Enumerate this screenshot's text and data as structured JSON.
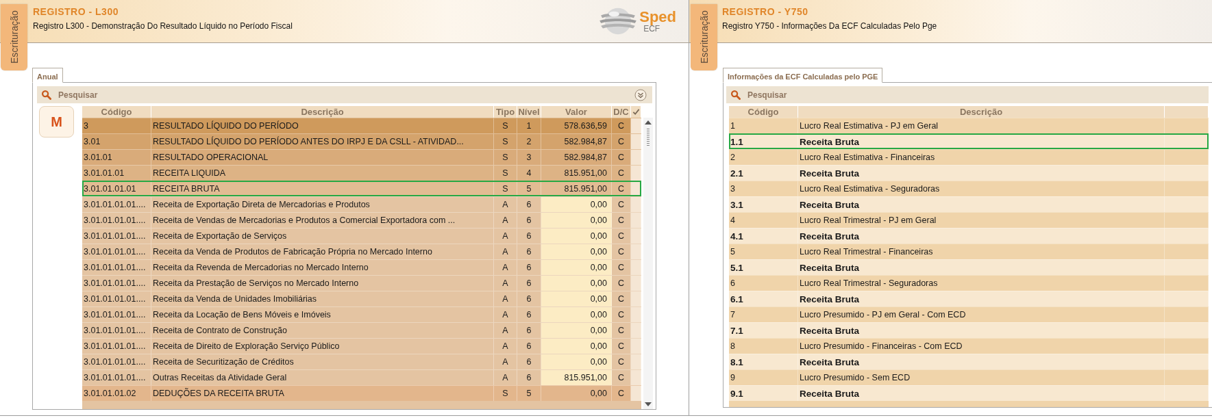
{
  "left_window": {
    "side_tab": "Escrituração",
    "title": "REGISTRO - L300",
    "subtitle": "Registro L300 - Demonstração Do Resultado Líquido no Período Fiscal",
    "logo": {
      "name": "Sped",
      "sub": "ECF"
    },
    "tabs": [
      {
        "label": "Anual",
        "selected": true
      }
    ],
    "search": {
      "label": "Pesquisar",
      "collapsible": true
    },
    "mode_badge": "M",
    "table": {
      "kind": "ledger",
      "columns": [
        "Código",
        "Descrição",
        "Tipo",
        "Nível",
        "Valor",
        "D/C"
      ],
      "rows": [
        {
          "codigo": "3",
          "descricao": "RESULTADO LÍQUIDO DO PERÍODO",
          "tipo": "S",
          "nivel": "1",
          "valor": "578.636,59",
          "dc": "C",
          "kind": "synthetic",
          "color": "#cf9a5c",
          "highlighted": false
        },
        {
          "codigo": "3.01",
          "descricao": "RESULTADO LÍQUIDO DO PERÍODO ANTES DO IRPJ E DA CSLL - ATIVIDAD...",
          "tipo": "S",
          "nivel": "2",
          "valor": "582.984,87",
          "dc": "C",
          "kind": "synthetic",
          "color": "#d4a36c",
          "highlighted": false
        },
        {
          "codigo": "3.01.01",
          "descricao": "RESULTADO OPERACIONAL",
          "tipo": "S",
          "nivel": "3",
          "valor": "582.984,87",
          "dc": "C",
          "kind": "synthetic",
          "color": "#d9ab7a",
          "highlighted": false
        },
        {
          "codigo": "3.01.01.01",
          "descricao": "RECEITA LIQUIDA",
          "tipo": "S",
          "nivel": "4",
          "valor": "815.951,00",
          "dc": "C",
          "kind": "synthetic",
          "color": "#ddb385",
          "highlighted": false
        },
        {
          "codigo": "3.01.01.01.01",
          "descricao": "RECEITA BRUTA",
          "tipo": "S",
          "nivel": "5",
          "valor": "815.951,00",
          "dc": "C",
          "kind": "synthetic",
          "color": "#e2bc93",
          "highlighted": true
        },
        {
          "codigo": "3.01.01.01.01....",
          "descricao": "Receita de Exportação Direta de Mercadorias e Produtos",
          "tipo": "A",
          "nivel": "6",
          "valor": "0,00",
          "dc": "C",
          "kind": "analytic",
          "color": "#e4c4a2",
          "highlighted": false
        },
        {
          "codigo": "3.01.01.01.01....",
          "descricao": "Receita de Vendas de Mercadorias e Produtos a Comercial Exportadora com ...",
          "tipo": "A",
          "nivel": "6",
          "valor": "0,00",
          "dc": "C",
          "kind": "analytic",
          "color": "#e4c4a2",
          "highlighted": false
        },
        {
          "codigo": "3.01.01.01.01....",
          "descricao": "Receita de Exportação de Serviços",
          "tipo": "A",
          "nivel": "6",
          "valor": "0,00",
          "dc": "C",
          "kind": "analytic",
          "color": "#e4c4a2",
          "highlighted": false
        },
        {
          "codigo": "3.01.01.01.01....",
          "descricao": "Receita da Venda de Produtos de Fabricação Própria no Mercado Interno",
          "tipo": "A",
          "nivel": "6",
          "valor": "0,00",
          "dc": "C",
          "kind": "analytic",
          "color": "#e4c4a2",
          "highlighted": false
        },
        {
          "codigo": "3.01.01.01.01....",
          "descricao": "Receita da Revenda de Mercadorias no Mercado Interno",
          "tipo": "A",
          "nivel": "6",
          "valor": "0,00",
          "dc": "C",
          "kind": "analytic",
          "color": "#e4c4a2",
          "highlighted": false
        },
        {
          "codigo": "3.01.01.01.01....",
          "descricao": "Receita da Prestação de Serviços no Mercado Interno",
          "tipo": "A",
          "nivel": "6",
          "valor": "0,00",
          "dc": "C",
          "kind": "analytic",
          "color": "#e4c4a2",
          "highlighted": false
        },
        {
          "codigo": "3.01.01.01.01....",
          "descricao": "Receita da Venda de Unidades Imobiliárias",
          "tipo": "A",
          "nivel": "6",
          "valor": "0,00",
          "dc": "C",
          "kind": "analytic",
          "color": "#e4c4a2",
          "highlighted": false
        },
        {
          "codigo": "3.01.01.01.01....",
          "descricao": "Receita da Locação de Bens Móveis e Imóveis",
          "tipo": "A",
          "nivel": "6",
          "valor": "0,00",
          "dc": "C",
          "kind": "analytic",
          "color": "#e4c4a2",
          "highlighted": false
        },
        {
          "codigo": "3.01.01.01.01....",
          "descricao": "Receita de Contrato de Construção",
          "tipo": "A",
          "nivel": "6",
          "valor": "0,00",
          "dc": "C",
          "kind": "analytic",
          "color": "#e4c4a2",
          "highlighted": false
        },
        {
          "codigo": "3.01.01.01.01....",
          "descricao": "Receita de Direito de Exploração Serviço Público",
          "tipo": "A",
          "nivel": "6",
          "valor": "0,00",
          "dc": "C",
          "kind": "analytic",
          "color": "#e4c4a2",
          "highlighted": false
        },
        {
          "codigo": "3.01.01.01.01....",
          "descricao": "Receita de Securitização de Créditos",
          "tipo": "A",
          "nivel": "6",
          "valor": "0,00",
          "dc": "C",
          "kind": "analytic",
          "color": "#e4c4a2",
          "highlighted": false
        },
        {
          "codigo": "3.01.01.01.01....",
          "descricao": "Outras Receitas da Atividade Geral",
          "tipo": "A",
          "nivel": "6",
          "valor": "815.951,00",
          "dc": "C",
          "kind": "analytic",
          "color": "#e4c4a2",
          "highlighted": false
        },
        {
          "codigo": "3.01.01.01.02",
          "descricao": "DEDUÇÕES DA RECEITA BRUTA",
          "tipo": "S",
          "nivel": "5",
          "valor": "0,00",
          "dc": "C",
          "kind": "synthetic",
          "color": "#e3b68c",
          "highlighted": false
        }
      ]
    }
  },
  "right_window": {
    "side_tab": "Escrituração",
    "title": "REGISTRO - Y750",
    "subtitle": "Registro Y750 - Informações Da ECF Calculadas Pelo Pge",
    "tabs": [
      {
        "label": "Informações da ECF Calculadas pelo PGE",
        "selected": true
      }
    ],
    "search": {
      "label": "Pesquisar",
      "collapsible": false
    },
    "table": {
      "kind": "summary",
      "columns": [
        "Código",
        "Descrição"
      ],
      "rows": [
        {
          "codigo": "1",
          "descricao": "Lucro Real Estimativa - PJ em Geral",
          "kind": "group",
          "highlighted": false
        },
        {
          "codigo": "1.1",
          "descricao": "Receita Bruta",
          "kind": "item",
          "highlighted": true
        },
        {
          "codigo": "2",
          "descricao": "Lucro Real Estimativa - Financeiras",
          "kind": "group",
          "highlighted": false
        },
        {
          "codigo": "2.1",
          "descricao": "Receita Bruta",
          "kind": "item",
          "highlighted": false
        },
        {
          "codigo": "3",
          "descricao": "Lucro Real Estimativa - Seguradoras",
          "kind": "group",
          "highlighted": false
        },
        {
          "codigo": "3.1",
          "descricao": "Receita Bruta",
          "kind": "item",
          "highlighted": false
        },
        {
          "codigo": "4",
          "descricao": "Lucro Real Trimestral - PJ em Geral",
          "kind": "group",
          "highlighted": false
        },
        {
          "codigo": "4.1",
          "descricao": "Receita Bruta",
          "kind": "item",
          "highlighted": false
        },
        {
          "codigo": "5",
          "descricao": "Lucro Real Trimestral - Financeiras",
          "kind": "group",
          "highlighted": false
        },
        {
          "codigo": "5.1",
          "descricao": "Receita Bruta",
          "kind": "item",
          "highlighted": false
        },
        {
          "codigo": "6",
          "descricao": "Lucro Real Trimestral - Seguradoras",
          "kind": "group",
          "highlighted": false
        },
        {
          "codigo": "6.1",
          "descricao": "Receita Bruta",
          "kind": "item",
          "highlighted": false
        },
        {
          "codigo": "7",
          "descricao": "Lucro Presumido - PJ em Geral - Com ECD",
          "kind": "group",
          "highlighted": false
        },
        {
          "codigo": "7.1",
          "descricao": "Receita Bruta",
          "kind": "item",
          "highlighted": false
        },
        {
          "codigo": "8",
          "descricao": "Lucro Presumido - Financeiras - Com ECD",
          "kind": "group",
          "highlighted": false
        },
        {
          "codigo": "8.1",
          "descricao": "Receita Bruta",
          "kind": "item",
          "highlighted": false
        },
        {
          "codigo": "9",
          "descricao": "Lucro Presumido - Sem ECD",
          "kind": "group",
          "highlighted": false
        },
        {
          "codigo": "9.1",
          "descricao": "Receita Bruta",
          "kind": "item",
          "highlighted": false
        }
      ]
    }
  }
}
